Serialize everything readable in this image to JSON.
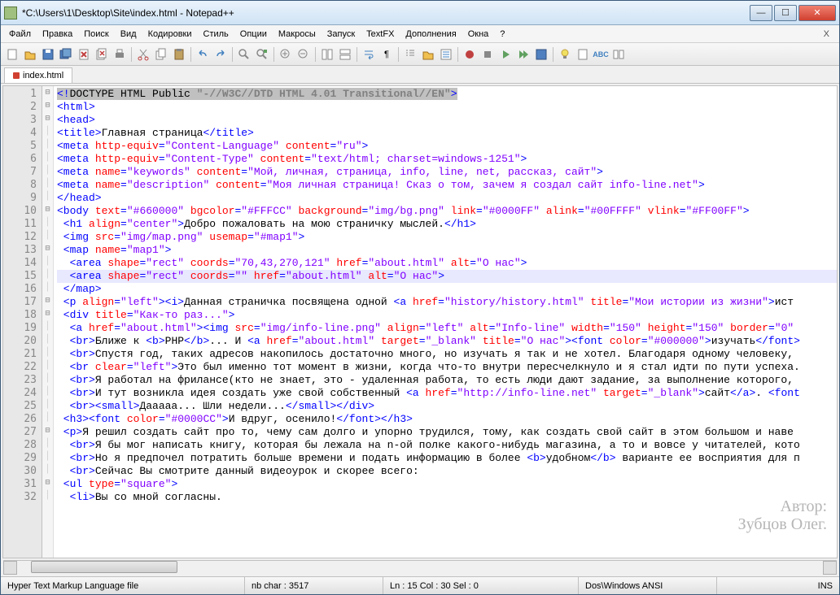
{
  "window": {
    "title": "*C:\\Users\\1\\Desktop\\Site\\index.html - Notepad++"
  },
  "menu": [
    "Файл",
    "Правка",
    "Поиск",
    "Вид",
    "Кодировки",
    "Стиль",
    "Опции",
    "Макросы",
    "Запуск",
    "TextFX",
    "Дополнения",
    "Окна",
    "?"
  ],
  "tab": {
    "label": "index.html"
  },
  "lines": {
    "count": 32,
    "folds": [
      "⊟",
      "⊟",
      "⊟",
      "",
      "",
      "",
      "",
      "",
      "",
      "⊟",
      "",
      "",
      "⊟",
      "",
      "",
      "",
      "⊟",
      "⊟",
      "",
      "",
      "",
      "",
      "",
      "",
      "",
      "",
      "⊟",
      "",
      "",
      "",
      "⊟",
      ""
    ]
  },
  "code": [
    [
      {
        "sel": true,
        "h": [
          [
            "t",
            "<!"
          ],
          [
            "c",
            "DOCTYPE HTML Public "
          ],
          [
            "s",
            "\"-//W3C//DTD HTML 4.01 Transitional//EN\""
          ],
          [
            "t",
            ">"
          ]
        ]
      }
    ],
    [
      {
        "h": [
          [
            "t",
            "<html>"
          ]
        ]
      }
    ],
    [
      {
        "h": [
          [
            "t",
            "<head>"
          ]
        ]
      }
    ],
    [
      {
        "h": [
          [
            "t",
            "<title>"
          ],
          [
            "c",
            "Главная страница"
          ],
          [
            "t",
            "</title>"
          ]
        ]
      }
    ],
    [
      {
        "h": [
          [
            "t",
            "<meta "
          ],
          [
            "a",
            "http-equiv"
          ],
          [
            "t",
            "="
          ],
          [
            "v",
            "\"Content-Language\""
          ],
          [
            "t",
            " "
          ],
          [
            "a",
            "content"
          ],
          [
            "t",
            "="
          ],
          [
            "v",
            "\"ru\""
          ],
          [
            "t",
            ">"
          ]
        ]
      }
    ],
    [
      {
        "h": [
          [
            "t",
            "<meta "
          ],
          [
            "a",
            "http-equiv"
          ],
          [
            "t",
            "="
          ],
          [
            "v",
            "\"Content-Type\""
          ],
          [
            "t",
            " "
          ],
          [
            "a",
            "content"
          ],
          [
            "t",
            "="
          ],
          [
            "v",
            "\"text/html; charset=windows-1251\""
          ],
          [
            "t",
            ">"
          ]
        ]
      }
    ],
    [
      {
        "h": [
          [
            "t",
            "<meta "
          ],
          [
            "a",
            "name"
          ],
          [
            "t",
            "="
          ],
          [
            "v",
            "\"keywords\""
          ],
          [
            "t",
            " "
          ],
          [
            "a",
            "content"
          ],
          [
            "t",
            "="
          ],
          [
            "v",
            "\"Мой, личная, страница, info, line, net, рассказ, сайт\""
          ],
          [
            "t",
            ">"
          ]
        ]
      }
    ],
    [
      {
        "h": [
          [
            "t",
            "<meta "
          ],
          [
            "a",
            "name"
          ],
          [
            "t",
            "="
          ],
          [
            "v",
            "\"description\""
          ],
          [
            "t",
            " "
          ],
          [
            "a",
            "content"
          ],
          [
            "t",
            "="
          ],
          [
            "v",
            "\"Моя личная страница! Сказ о том, зачем я создал сайт info-line.net\""
          ],
          [
            "t",
            ">"
          ]
        ]
      }
    ],
    [
      {
        "h": [
          [
            "t",
            "</head>"
          ]
        ]
      }
    ],
    [
      {
        "h": [
          [
            "t",
            "<body "
          ],
          [
            "a",
            "text"
          ],
          [
            "t",
            "="
          ],
          [
            "v",
            "\"#660000\""
          ],
          [
            "t",
            " "
          ],
          [
            "a",
            "bgcolor"
          ],
          [
            "t",
            "="
          ],
          [
            "v",
            "\"#FFFCC\""
          ],
          [
            "t",
            " "
          ],
          [
            "a",
            "background"
          ],
          [
            "t",
            "="
          ],
          [
            "v",
            "\"img/bg.png\""
          ],
          [
            "t",
            " "
          ],
          [
            "a",
            "link"
          ],
          [
            "t",
            "="
          ],
          [
            "v",
            "\"#0000FF\""
          ],
          [
            "t",
            " "
          ],
          [
            "a",
            "alink"
          ],
          [
            "t",
            "="
          ],
          [
            "v",
            "\"#00FFFF\""
          ],
          [
            "t",
            " "
          ],
          [
            "a",
            "vlink"
          ],
          [
            "t",
            "="
          ],
          [
            "v",
            "\"#FF00FF\""
          ],
          [
            "t",
            ">"
          ]
        ]
      }
    ],
    [
      {
        "h": [
          [
            "t",
            " <h1 "
          ],
          [
            "a",
            "align"
          ],
          [
            "t",
            "="
          ],
          [
            "v",
            "\"center\""
          ],
          [
            "t",
            ">"
          ],
          [
            "c",
            "Добро пожаловать на мою страничку мыслей."
          ],
          [
            "t",
            "</h1>"
          ]
        ]
      }
    ],
    [
      {
        "h": [
          [
            "t",
            " <img "
          ],
          [
            "a",
            "src"
          ],
          [
            "t",
            "="
          ],
          [
            "v",
            "\"img/map.png\""
          ],
          [
            "t",
            " "
          ],
          [
            "a",
            "usemap"
          ],
          [
            "t",
            "="
          ],
          [
            "v",
            "\"#map1\""
          ],
          [
            "t",
            ">"
          ]
        ]
      }
    ],
    [
      {
        "h": [
          [
            "t",
            " <map "
          ],
          [
            "a",
            "name"
          ],
          [
            "t",
            "="
          ],
          [
            "v",
            "\"map1\""
          ],
          [
            "t",
            ">"
          ]
        ]
      }
    ],
    [
      {
        "h": [
          [
            "t",
            "  <area "
          ],
          [
            "a",
            "shape"
          ],
          [
            "t",
            "="
          ],
          [
            "v",
            "\"rect\""
          ],
          [
            "t",
            " "
          ],
          [
            "a",
            "coords"
          ],
          [
            "t",
            "="
          ],
          [
            "v",
            "\"70,43,270,121\""
          ],
          [
            "t",
            " "
          ],
          [
            "a",
            "href"
          ],
          [
            "t",
            "="
          ],
          [
            "v",
            "\"about.html\""
          ],
          [
            "t",
            " "
          ],
          [
            "a",
            "alt"
          ],
          [
            "t",
            "="
          ],
          [
            "v",
            "\"О нас\""
          ],
          [
            "t",
            ">"
          ]
        ]
      }
    ],
    [
      {
        "hl": true,
        "h": [
          [
            "t",
            "  <area "
          ],
          [
            "a",
            "shape"
          ],
          [
            "t",
            "="
          ],
          [
            "v",
            "\"rect\""
          ],
          [
            "t",
            " "
          ],
          [
            "a",
            "coords"
          ],
          [
            "t",
            "="
          ],
          [
            "v",
            "\"\""
          ],
          [
            "t",
            " "
          ],
          [
            "a",
            "href"
          ],
          [
            "t",
            "="
          ],
          [
            "v",
            "\"about.html\""
          ],
          [
            "t",
            " "
          ],
          [
            "a",
            "alt"
          ],
          [
            "t",
            "="
          ],
          [
            "v",
            "\"О нас\""
          ],
          [
            "t",
            ">"
          ]
        ]
      }
    ],
    [
      {
        "h": [
          [
            "t",
            " </map>"
          ]
        ]
      }
    ],
    [
      {
        "h": [
          [
            "t",
            " <p "
          ],
          [
            "a",
            "align"
          ],
          [
            "t",
            "="
          ],
          [
            "v",
            "\"left\""
          ],
          [
            "t",
            "><i>"
          ],
          [
            "c",
            "Данная страничка посвящена одной "
          ],
          [
            "t",
            "<a "
          ],
          [
            "a",
            "href"
          ],
          [
            "t",
            "="
          ],
          [
            "v",
            "\"history/history.html\""
          ],
          [
            "t",
            " "
          ],
          [
            "a",
            "title"
          ],
          [
            "t",
            "="
          ],
          [
            "v",
            "\"Мои истории из жизни\""
          ],
          [
            "t",
            ">"
          ],
          [
            "c",
            "ист"
          ]
        ]
      }
    ],
    [
      {
        "h": [
          [
            "t",
            " <div "
          ],
          [
            "a",
            "title"
          ],
          [
            "t",
            "="
          ],
          [
            "v",
            "\"Как-то раз...\""
          ],
          [
            "t",
            ">"
          ]
        ]
      }
    ],
    [
      {
        "h": [
          [
            "t",
            "  <a "
          ],
          [
            "a",
            "href"
          ],
          [
            "t",
            "="
          ],
          [
            "v",
            "\"about.html\""
          ],
          [
            "t",
            "><img "
          ],
          [
            "a",
            "src"
          ],
          [
            "t",
            "="
          ],
          [
            "v",
            "\"img/info-line.png\""
          ],
          [
            "t",
            " "
          ],
          [
            "a",
            "align"
          ],
          [
            "t",
            "="
          ],
          [
            "v",
            "\"left\""
          ],
          [
            "t",
            " "
          ],
          [
            "a",
            "alt"
          ],
          [
            "t",
            "="
          ],
          [
            "v",
            "\"Info-line\""
          ],
          [
            "t",
            " "
          ],
          [
            "a",
            "width"
          ],
          [
            "t",
            "="
          ],
          [
            "v",
            "\"150\""
          ],
          [
            "t",
            " "
          ],
          [
            "a",
            "height"
          ],
          [
            "t",
            "="
          ],
          [
            "v",
            "\"150\""
          ],
          [
            "t",
            " "
          ],
          [
            "a",
            "border"
          ],
          [
            "t",
            "="
          ],
          [
            "v",
            "\"0\""
          ]
        ]
      }
    ],
    [
      {
        "h": [
          [
            "t",
            "  <br>"
          ],
          [
            "c",
            "Ближе к "
          ],
          [
            "t",
            "<b>"
          ],
          [
            "c",
            "PHP"
          ],
          [
            "t",
            "</b>"
          ],
          [
            "c",
            "... И "
          ],
          [
            "t",
            "<a "
          ],
          [
            "a",
            "href"
          ],
          [
            "t",
            "="
          ],
          [
            "v",
            "\"about.html\""
          ],
          [
            "t",
            " "
          ],
          [
            "a",
            "target"
          ],
          [
            "t",
            "="
          ],
          [
            "v",
            "\"_blank\""
          ],
          [
            "t",
            " "
          ],
          [
            "a",
            "title"
          ],
          [
            "t",
            "="
          ],
          [
            "v",
            "\"О нас\""
          ],
          [
            "t",
            "><font "
          ],
          [
            "a",
            "color"
          ],
          [
            "t",
            "="
          ],
          [
            "v",
            "\"#000000\""
          ],
          [
            "t",
            ">"
          ],
          [
            "c",
            "изучать"
          ],
          [
            "t",
            "</font>"
          ]
        ]
      }
    ],
    [
      {
        "h": [
          [
            "t",
            "  <br>"
          ],
          [
            "c",
            "Спустя год, таких адресов накопилось достаточно много, но изучать я так и не хотел. Благодаря одному человеку,"
          ]
        ]
      }
    ],
    [
      {
        "h": [
          [
            "t",
            "  <br "
          ],
          [
            "a",
            "clear"
          ],
          [
            "t",
            "="
          ],
          [
            "v",
            "\"left\""
          ],
          [
            "t",
            ">"
          ],
          [
            "c",
            "Это был именно тот момент в жизни, когда что-то внутри пересчелкнуло и я стал идти по пути успеха."
          ]
        ]
      }
    ],
    [
      {
        "h": [
          [
            "t",
            "  <br>"
          ],
          [
            "c",
            "Я работал на фрилансе(кто не знает, это - удаленная работа, то есть люди дают задание, за выполнение которого,"
          ]
        ]
      }
    ],
    [
      {
        "h": [
          [
            "t",
            "  <br>"
          ],
          [
            "c",
            "И тут возникла идея создать уже свой собственный "
          ],
          [
            "t",
            "<a "
          ],
          [
            "a",
            "href"
          ],
          [
            "t",
            "="
          ],
          [
            "v",
            "\"http://info-line.net\""
          ],
          [
            "t",
            " "
          ],
          [
            "a",
            "target"
          ],
          [
            "t",
            "="
          ],
          [
            "v",
            "\"_blank\""
          ],
          [
            "t",
            ">"
          ],
          [
            "c",
            "сайт"
          ],
          [
            "t",
            "</a>"
          ],
          [
            "c",
            ". "
          ],
          [
            "t",
            "<font"
          ]
        ]
      }
    ],
    [
      {
        "h": [
          [
            "t",
            "  <br><small>"
          ],
          [
            "c",
            "Дааааа... Шли недели..."
          ],
          [
            "t",
            "</small></div>"
          ]
        ]
      }
    ],
    [
      {
        "h": [
          [
            "t",
            " <h3><font "
          ],
          [
            "a",
            "color"
          ],
          [
            "t",
            "="
          ],
          [
            "v",
            "\"#0000CC\""
          ],
          [
            "t",
            ">"
          ],
          [
            "c",
            "И вдруг, осенило!"
          ],
          [
            "t",
            "</font></h3>"
          ]
        ]
      }
    ],
    [
      {
        "h": [
          [
            "t",
            " <p>"
          ],
          [
            "c",
            "Я решил создать сайт про то, чему сам долго и упорно трудился, тому, как создать свой сайт в этом большом и наве"
          ]
        ]
      }
    ],
    [
      {
        "h": [
          [
            "t",
            "  <br>"
          ],
          [
            "c",
            "Я бы мог написать книгу, которая бы лежала на n-ой полке какого-нибудь магазина, а то и вовсе у читателей, кото"
          ]
        ]
      }
    ],
    [
      {
        "h": [
          [
            "t",
            "  <br>"
          ],
          [
            "c",
            "Но я предпочел потратить больше времени и подать информацию в более "
          ],
          [
            "t",
            "<b>"
          ],
          [
            "c",
            "удобном"
          ],
          [
            "t",
            "</b>"
          ],
          [
            "c",
            " варианте ее восприятия для п"
          ]
        ]
      }
    ],
    [
      {
        "h": [
          [
            "t",
            "  <br>"
          ],
          [
            "c",
            "Сейчас Вы смотрите данный видеоурок и скорее всего:"
          ]
        ]
      }
    ],
    [
      {
        "h": [
          [
            "t",
            " <ul "
          ],
          [
            "a",
            "type"
          ],
          [
            "t",
            "="
          ],
          [
            "v",
            "\"square\""
          ],
          [
            "t",
            ">"
          ]
        ]
      }
    ],
    [
      {
        "h": [
          [
            "t",
            "  <li>"
          ],
          [
            "c",
            "Вы со мной согласны."
          ]
        ]
      }
    ]
  ],
  "status": {
    "filetype": "Hyper Text Markup Language file",
    "chars": "nb char : 3517",
    "pos": "Ln : 15   Col : 30   Sel : 0",
    "enc": "Dos\\Windows  ANSI",
    "mode": "INS"
  },
  "watermark": {
    "l1": "Автор:",
    "l2": "Зубцов Олег."
  }
}
